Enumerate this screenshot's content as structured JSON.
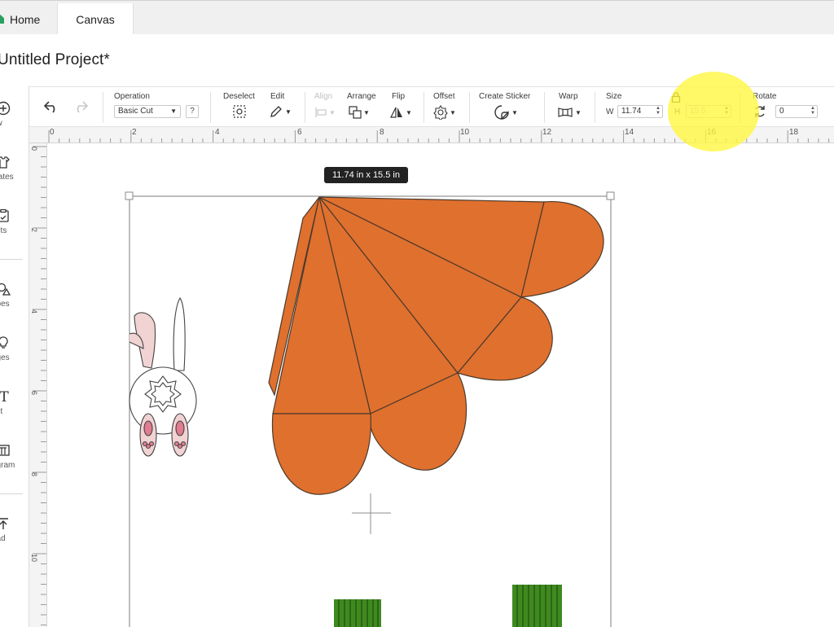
{
  "tabs": [
    {
      "label": "Home"
    },
    {
      "label": "Canvas"
    }
  ],
  "project": {
    "title": "Untitled Project*"
  },
  "sidebar": {
    "items": [
      {
        "icon": "plus-circle-icon",
        "label": "ew"
      },
      {
        "icon": "templates-shirt-icon",
        "label": "plates"
      },
      {
        "icon": "projects-icon",
        "label": "ects"
      },
      {
        "icon": "shapes-icon",
        "label": "apes"
      },
      {
        "icon": "images-bulb-icon",
        "label": "ages"
      },
      {
        "icon": "text-icon",
        "label": "ext"
      },
      {
        "icon": "monogram-icon",
        "label": "ogram"
      },
      {
        "icon": "upload-icon",
        "label": "oad"
      }
    ]
  },
  "toolbar": {
    "undo_icon": "undo-icon",
    "redo_icon": "redo-icon",
    "operation": {
      "label": "Operation",
      "value": "Basic Cut",
      "help": "?"
    },
    "deselect": {
      "label": "Deselect"
    },
    "edit": {
      "label": "Edit"
    },
    "align": {
      "label": "Align"
    },
    "arrange": {
      "label": "Arrange"
    },
    "flip": {
      "label": "Flip"
    },
    "offset": {
      "label": "Offset"
    },
    "create_sticker": {
      "label": "Create Sticker"
    },
    "warp": {
      "label": "Warp"
    },
    "size": {
      "label": "Size",
      "w_label": "W",
      "w_value": "11.74",
      "h_label": "H",
      "h_value": "15.5"
    },
    "rotate": {
      "label": "Rotate",
      "value": "0"
    }
  },
  "ruler": {
    "top_ticks": [
      "0",
      "2",
      "4",
      "6",
      "8",
      "10",
      "12",
      "14",
      "16",
      "18"
    ],
    "left_ticks": [
      "0",
      "2",
      "4",
      "6",
      "8",
      "10"
    ]
  },
  "canvas": {
    "dimension_tooltip": "11.74  in x 15.5  in",
    "carrot_color": "#e0702e",
    "stem_color": "#3f8a1f",
    "bunny_ear_color": "#f1d3d3"
  },
  "highlight_color": "#fff63c"
}
